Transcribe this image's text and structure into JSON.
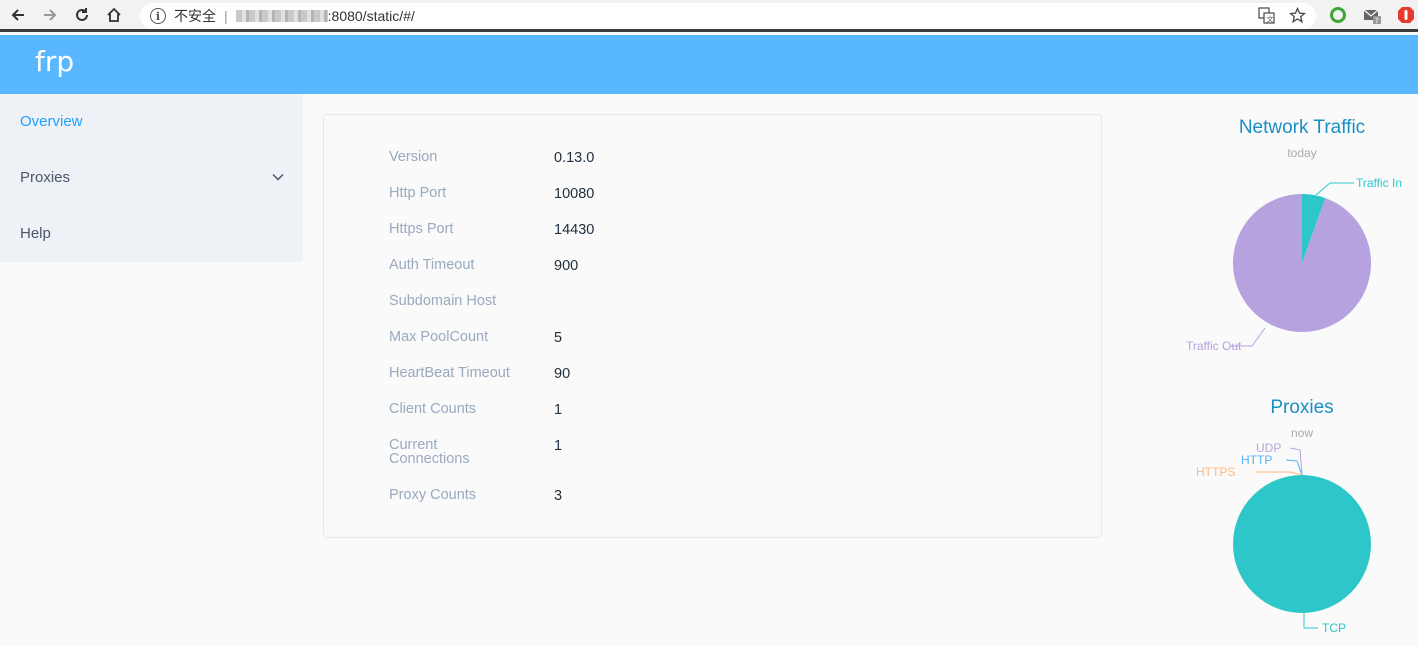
{
  "browser": {
    "insecure_label": "不安全",
    "url_suffix": ":8080/static/#/"
  },
  "app": {
    "title": "frp"
  },
  "sidebar": {
    "items": [
      {
        "label": "Overview",
        "active": true
      },
      {
        "label": "Proxies",
        "expandable": true
      },
      {
        "label": "Help"
      }
    ]
  },
  "overview": {
    "rows": [
      {
        "label": "Version",
        "value": "0.13.0"
      },
      {
        "label": "Http Port",
        "value": "10080"
      },
      {
        "label": "Https Port",
        "value": "14430"
      },
      {
        "label": "Auth Timeout",
        "value": "900"
      },
      {
        "label": "Subdomain Host",
        "value": ""
      },
      {
        "label": "Max PoolCount",
        "value": "5"
      },
      {
        "label": "HeartBeat Timeout",
        "value": "90"
      },
      {
        "label": "Client Counts",
        "value": "1"
      },
      {
        "label": "Current Connections",
        "value": "1"
      },
      {
        "label": "Proxy Counts",
        "value": "3"
      }
    ]
  },
  "colors": {
    "header": "#58b7ff",
    "active_menu": "#20a0ff",
    "traffic_in": "#2ec7c9",
    "traffic_out": "#b6a2de",
    "tcp": "#2ec7c9",
    "udp": "#b6a2de",
    "http": "#5ab1ef",
    "https": "#ffb980"
  },
  "chart_data": [
    {
      "type": "pie",
      "title": "Network Traffic",
      "subtitle": "today",
      "categories": [
        "Traffic In",
        "Traffic Out"
      ],
      "values": [
        5.5,
        94.5
      ]
    },
    {
      "type": "pie",
      "title": "Proxies",
      "subtitle": "now",
      "categories": [
        "TCP",
        "UDP",
        "HTTP",
        "HTTPS"
      ],
      "values": [
        3,
        0,
        0,
        0
      ]
    }
  ]
}
